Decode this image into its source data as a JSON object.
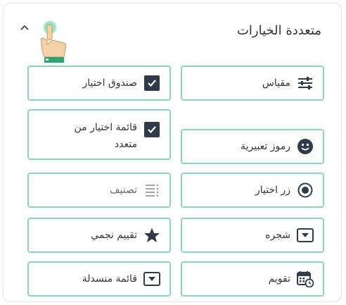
{
  "panel": {
    "title": "متعددة الخيارات"
  },
  "items": {
    "measure": {
      "label": "مقياس",
      "icon": "sliders-icon"
    },
    "checkbox": {
      "label": "صندوق اختيار",
      "icon": "checkbox-checked-icon"
    },
    "emoji": {
      "label": "رموز تعبيرية",
      "icon": "smiley-icon"
    },
    "multiselect": {
      "label": "قائمة اختيار من متعدد",
      "icon": "checkbox-checked-icon"
    },
    "radio": {
      "label": "زر اختيار",
      "icon": "radio-icon"
    },
    "classify": {
      "label": "تصنيف",
      "icon": "list-icon"
    },
    "tree": {
      "label": "شجره",
      "icon": "dropdown-icon"
    },
    "stars": {
      "label": "تقييم نجمي",
      "icon": "star-icon"
    },
    "calendar": {
      "label": "تقويم",
      "icon": "calendar-icon"
    },
    "dropdown": {
      "label": "قائمة منسدلة",
      "icon": "dropdown-icon"
    }
  },
  "colors": {
    "card_border": "#8bd6b6",
    "icon_dark": "#2f3a4a",
    "accent_green": "#3cc88c"
  }
}
